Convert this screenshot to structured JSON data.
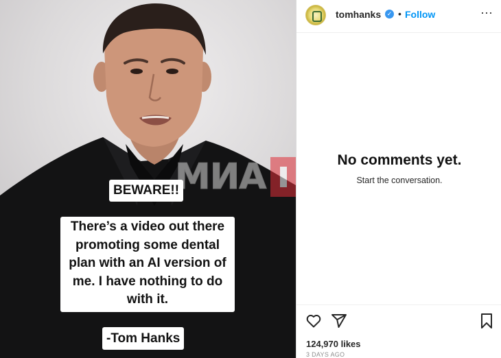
{
  "post": {
    "captions": {
      "beware": "BEWARE!!",
      "main": "There’s a video out there promoting some dental plan with an AI version of me.  I have nothing to do with it.",
      "signature": "-Tom Hanks"
    },
    "watermark_text": "МИА"
  },
  "header": {
    "username": "tomhanks",
    "verified_icon": "verified-badge-icon",
    "separator": "•",
    "follow_label": "Follow",
    "more_icon": "···"
  },
  "comments": {
    "empty_title": "No comments yet.",
    "empty_subtitle": "Start the conversation."
  },
  "actions": {
    "like_icon": "heart-icon",
    "share_icon": "paper-plane-icon",
    "save_icon": "bookmark-icon"
  },
  "stats": {
    "likes": "124,970 likes",
    "time": "3 DAYS AGO"
  },
  "colors": {
    "accent": "#0095f6",
    "verified": "#3897f0",
    "text": "#262626",
    "muted": "#8e8e8e"
  }
}
